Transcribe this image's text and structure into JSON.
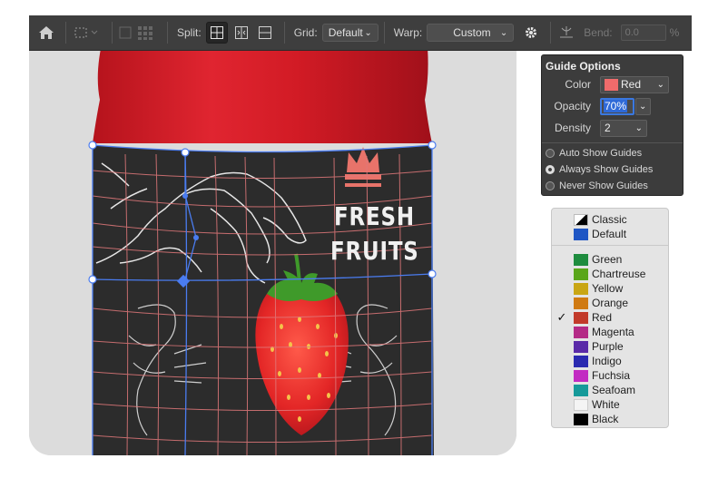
{
  "toolbar": {
    "split_label": "Split:",
    "grid_label": "Grid:",
    "grid_value": "Default",
    "warp_label": "Warp:",
    "warp_value": "Custom",
    "bend_label": "Bend:",
    "bend_value": "0.0",
    "bend_unit": "%"
  },
  "label": {
    "line1": "FRESH",
    "line2": "FRUITS"
  },
  "guide_options": {
    "title": "Guide Options",
    "color_label": "Color",
    "color_value": "Red",
    "color_swatch": "#f06b6b",
    "opacity_label": "Opacity",
    "opacity_value": "70%",
    "density_label": "Density",
    "density_value": "2",
    "options": [
      {
        "label": "Auto Show Guides",
        "selected": false
      },
      {
        "label": "Always Show Guides",
        "selected": true
      },
      {
        "label": "Never Show Guides",
        "selected": false
      }
    ]
  },
  "color_menu": {
    "items": [
      {
        "label": "Classic",
        "color": "classic",
        "checked": false
      },
      {
        "label": "Default",
        "color": "#1f56c4",
        "checked": false
      },
      {
        "label": "Green",
        "color": "#1e8c3e",
        "checked": false
      },
      {
        "label": "Chartreuse",
        "color": "#5aa61a",
        "checked": false
      },
      {
        "label": "Yellow",
        "color": "#c9a614",
        "checked": false
      },
      {
        "label": "Orange",
        "color": "#d07a12",
        "checked": false
      },
      {
        "label": "Red",
        "color": "#c23a2a",
        "checked": true
      },
      {
        "label": "Magenta",
        "color": "#b42a86",
        "checked": false
      },
      {
        "label": "Purple",
        "color": "#5a2aa8",
        "checked": false
      },
      {
        "label": "Indigo",
        "color": "#2a2ab0",
        "checked": false
      },
      {
        "label": "Fuchsia",
        "color": "#c22ac2",
        "checked": false
      },
      {
        "label": "Seafoam",
        "color": "#169a9a",
        "checked": false
      },
      {
        "label": "White",
        "color": "#f4f4f4",
        "checked": false
      },
      {
        "label": "Black",
        "color": "#000000",
        "checked": false
      }
    ]
  },
  "colors": {
    "guide_blue": "#4a7cf0",
    "guide_red": "#e0787a"
  }
}
